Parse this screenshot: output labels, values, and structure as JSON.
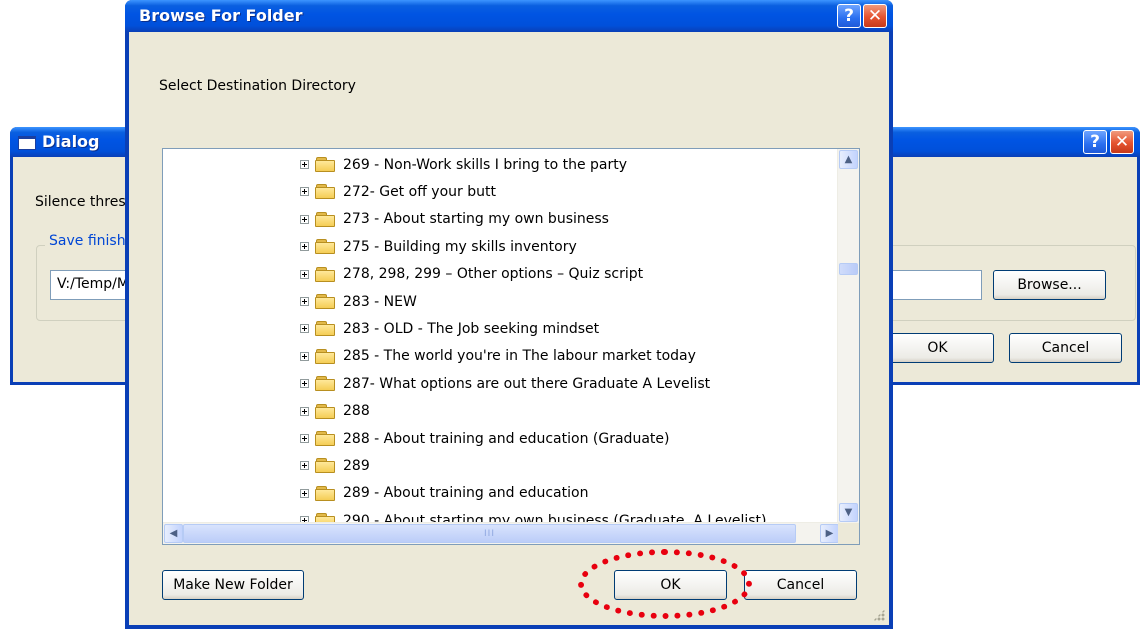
{
  "bg_dialog": {
    "title": "Dialog",
    "help_button": "?",
    "close_button": "✕",
    "silence_label": "Silence thres",
    "groupbox_label": "Save finish",
    "path_value": "V:/Temp/M",
    "browse_button": "Browse...",
    "ok_button": "OK",
    "cancel_button": "Cancel"
  },
  "browse_dialog": {
    "title": "Browse For Folder",
    "help_button": "?",
    "close_button": "✕",
    "instruction": "Select Destination Directory",
    "folders": [
      "269 - Non-Work skills I bring to the party",
      "272- Get off your butt",
      "273 - About starting my own business",
      "275 - Building my skills inventory",
      "278, 298, 299 – Other options – Quiz script",
      "283 - NEW",
      "283 - OLD - The Job seeking mindset",
      "285 - The world you're in The labour market today",
      "287- What options are out there Graduate A Levelist",
      "288",
      "288 - About training and education (Graduate)",
      "289",
      "289 - About training and education",
      "290 - About starting my own business (Graduate, A Levelist)"
    ],
    "make_new_folder_button": "Make New Folder",
    "ok_button": "OK",
    "cancel_button": "Cancel",
    "scroll_up": "▲",
    "scroll_down": "▼",
    "scroll_left": "◀",
    "scroll_right": "▶",
    "hthumb_grip": "III"
  },
  "colors": {
    "title_blue": "#0054e3",
    "dialog_face": "#ece9d8",
    "highlight_red": "#e8000f"
  }
}
